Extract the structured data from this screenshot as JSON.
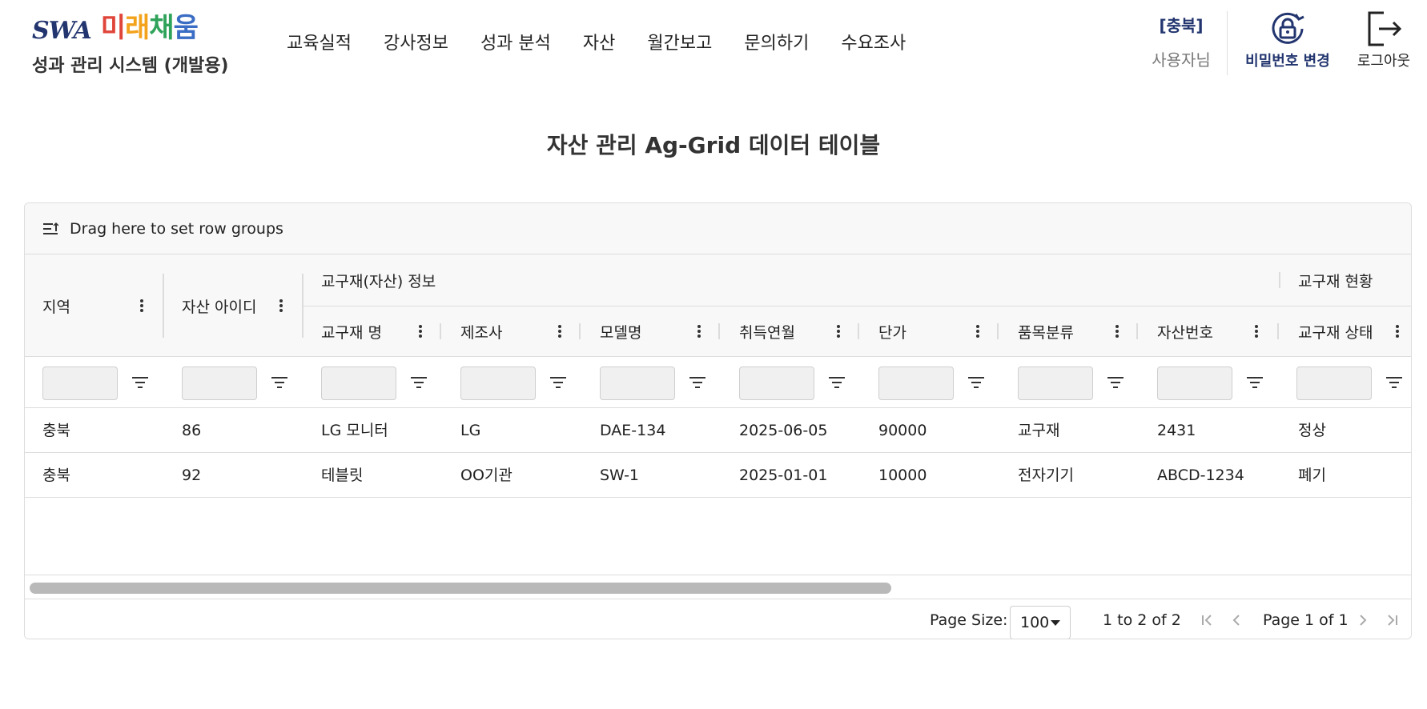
{
  "brand": {
    "swa": "SWA",
    "kr_chars": [
      "미",
      "래",
      "채",
      "움"
    ],
    "subtitle": "성과 관리 시스템 (개발용)"
  },
  "nav": [
    "교육실적",
    "강사정보",
    "성과 분석",
    "자산",
    "월간보고",
    "문의하기",
    "수요조사"
  ],
  "user": {
    "region": "[충북]",
    "name": "사용자님",
    "password_label": "비밀번호 변경",
    "logout_label": "로그아웃"
  },
  "page_title": "자산 관리 Ag-Grid 데이터 테이블",
  "grid": {
    "group_panel_text": "Drag here to set row groups",
    "group_headers": [
      "교구재(자산) 정보",
      "교구재 현황"
    ],
    "columns": [
      "지역",
      "자산 아이디",
      "교구재 명",
      "제조사",
      "모델명",
      "취득연월",
      "단가",
      "품목분류",
      "자산번호",
      "교구재 상태"
    ],
    "rows": [
      [
        "충북",
        "86",
        "LG 모니터",
        "LG",
        "DAE-134",
        "2025-06-05",
        "90000",
        "교구재",
        "2431",
        "정상"
      ],
      [
        "충북",
        "92",
        "테블릿",
        "OO기관",
        "SW-1",
        "2025-01-01",
        "10000",
        "전자기기",
        "ABCD-1234",
        "폐기"
      ]
    ],
    "page_size_label": "Page Size:",
    "page_size_value": "100",
    "summary": "1 to 2 of 2",
    "page_text": "Page 1 of 1"
  },
  "colors": {
    "brand_navy": "#22356f",
    "border": "#dddddd",
    "header_bg": "#f8f8f8"
  }
}
